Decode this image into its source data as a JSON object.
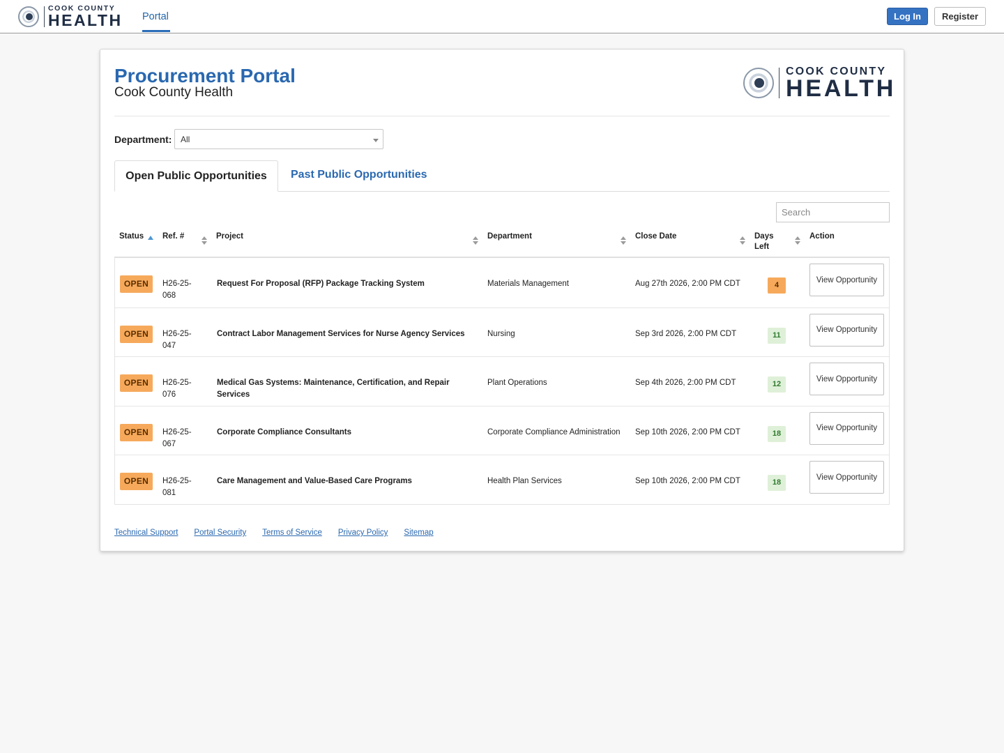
{
  "topbar": {
    "brand_small": "COOK COUNTY",
    "brand_big": "HEALTH",
    "nav_portal": "Portal",
    "login_label": "Log In",
    "register_label": "Register"
  },
  "header": {
    "title": "Procurement Portal",
    "subtitle": "Cook County Health",
    "logo_small": "COOK COUNTY",
    "logo_big": "HEALTH"
  },
  "filter": {
    "department_label": "Department:",
    "department_value": "All"
  },
  "tabs": {
    "open_label": "Open Public Opportunities",
    "past_label": "Past Public Opportunities"
  },
  "search": {
    "placeholder": "Search"
  },
  "table": {
    "headers": {
      "status": "Status",
      "ref": "Ref. #",
      "project": "Project",
      "department": "Department",
      "close_date": "Close Date",
      "days_left": "Days Left",
      "action": "Action"
    },
    "rows": [
      {
        "status": "OPEN",
        "ref": "H26-25-068",
        "project": "Request For Proposal (RFP) Package Tracking System",
        "department": "Materials Management",
        "close_date": "Aug 27th 2026, 2:00 PM CDT",
        "days_left": "4",
        "action": "View Opportunity"
      },
      {
        "status": "OPEN",
        "ref": "H26-25-047",
        "project": "Contract Labor Management Services for Nurse Agency Services",
        "department": "Nursing",
        "close_date": "Sep 3rd 2026, 2:00 PM CDT",
        "days_left": "11",
        "action": "View Opportunity"
      },
      {
        "status": "OPEN",
        "ref": "H26-25-076",
        "project": "Medical Gas Systems: Maintenance, Certification, and Repair Services",
        "department": "Plant Operations",
        "close_date": "Sep 4th 2026, 2:00 PM CDT",
        "days_left": "12",
        "action": "View Opportunity"
      },
      {
        "status": "OPEN",
        "ref": "H26-25-067",
        "project": "Corporate Compliance Consultants",
        "department": "Corporate Compliance Administration",
        "close_date": "Sep 10th 2026, 2:00 PM CDT",
        "days_left": "18",
        "action": "View Opportunity"
      },
      {
        "status": "OPEN",
        "ref": "H26-25-081",
        "project": "Care Management and Value-Based Care Programs",
        "department": "Health Plan Services",
        "close_date": "Sep 10th 2026, 2:00 PM CDT",
        "days_left": "18",
        "action": "View Opportunity"
      }
    ]
  },
  "footer": {
    "links": [
      "Technical Support",
      "Portal Security",
      "Terms of Service",
      "Privacy Policy",
      "Sitemap"
    ]
  },
  "colors": {
    "brand_blue": "#2a68b0",
    "open_badge": "#f6a95b",
    "days_green_bg": "#dff0d8"
  }
}
